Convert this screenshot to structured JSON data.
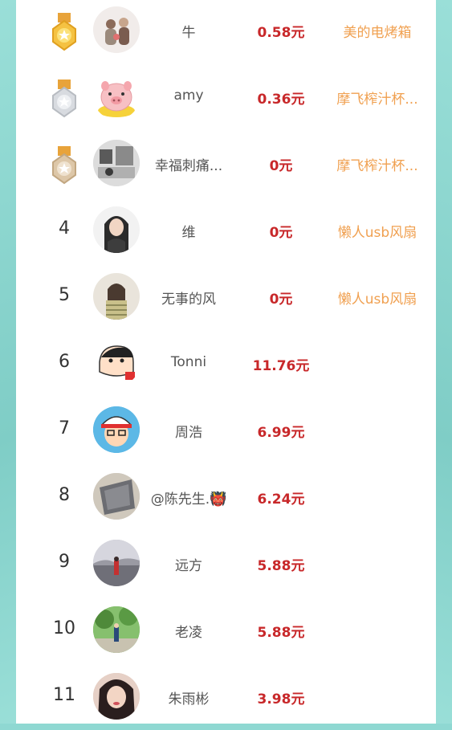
{
  "rows": [
    {
      "rank": "",
      "medal": "gold",
      "name": "牛",
      "amount": "0.58元",
      "prize": "美的电烤箱"
    },
    {
      "rank": "",
      "medal": "silver",
      "name": "amy",
      "amount": "0.36元",
      "prize": "摩飞榨汁杯..."
    },
    {
      "rank": "",
      "medal": "bronze",
      "name": "幸福刺痛...",
      "amount": "0元",
      "prize": "摩飞榨汁杯..."
    },
    {
      "rank": "4",
      "name": "维",
      "amount": "0元",
      "prize": "懒人usb风扇"
    },
    {
      "rank": "5",
      "name": "无事的风",
      "amount": "0元",
      "prize": "懒人usb风扇"
    },
    {
      "rank": "6",
      "name": "Tonni",
      "amount": "11.76元",
      "prize": ""
    },
    {
      "rank": "7",
      "name": "周浩",
      "amount": "6.99元",
      "prize": ""
    },
    {
      "rank": "8",
      "name": "@陈先生.👹",
      "amount": "6.24元",
      "prize": ""
    },
    {
      "rank": "9",
      "name": "远方",
      "amount": "5.88元",
      "prize": ""
    },
    {
      "rank": "10",
      "name": "老凌",
      "amount": "5.88元",
      "prize": ""
    },
    {
      "rank": "11",
      "name": "朱雨彬",
      "amount": "3.98元",
      "prize": ""
    }
  ],
  "colors": {
    "gold": "#f5c242",
    "silver": "#cfd3d8",
    "bronze": "#d8c0a0",
    "amount": "#c8282a",
    "prize": "#f0a050",
    "background": "#8fd8d2"
  }
}
